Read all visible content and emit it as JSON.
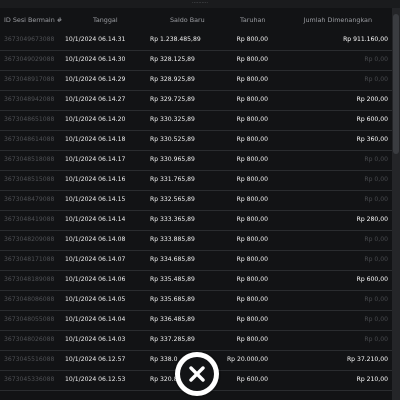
{
  "top_caption": "..........",
  "table": {
    "headers": [
      "ID Sesi Bermain #",
      "Tanggal",
      "Saldo Baru",
      "Taruhan",
      "Jumlah Dimenangkan"
    ],
    "rows": [
      {
        "id": "3673049673088",
        "date": "10/1/2024 06.14.31",
        "saldo": "Rp 1.238.485,89",
        "bet": "Rp 800,00",
        "win": "Rp 911.160,00"
      },
      {
        "id": "3673049029088",
        "date": "10/1/2024 06.14.30",
        "saldo": "Rp 328.125,89",
        "bet": "Rp 800,00",
        "win": "Rp 0,00"
      },
      {
        "id": "3673048917088",
        "date": "10/1/2024 06.14.29",
        "saldo": "Rp 328.925,89",
        "bet": "Rp 800,00",
        "win": "Rp 0,00"
      },
      {
        "id": "3673048942088",
        "date": "10/1/2024 06.14.27",
        "saldo": "Rp 329.725,89",
        "bet": "Rp 800,00",
        "win": "Rp 200,00"
      },
      {
        "id": "3673048651088",
        "date": "10/1/2024 06.14.20",
        "saldo": "Rp 330.325,89",
        "bet": "Rp 800,00",
        "win": "Rp 600,00"
      },
      {
        "id": "3673048614088",
        "date": "10/1/2024 06.14.18",
        "saldo": "Rp 330.525,89",
        "bet": "Rp 800,00",
        "win": "Rp 360,00"
      },
      {
        "id": "3673048518088",
        "date": "10/1/2024 06.14.17",
        "saldo": "Rp 330.965,89",
        "bet": "Rp 800,00",
        "win": "Rp 0,00"
      },
      {
        "id": "3673048515088",
        "date": "10/1/2024 06.14.16",
        "saldo": "Rp 331.765,89",
        "bet": "Rp 800,00",
        "win": "Rp 0,00"
      },
      {
        "id": "3673048479088",
        "date": "10/1/2024 06.14.15",
        "saldo": "Rp 332.565,89",
        "bet": "Rp 800,00",
        "win": "Rp 0,00"
      },
      {
        "id": "3673048419088",
        "date": "10/1/2024 06.14.14",
        "saldo": "Rp 333.365,89",
        "bet": "Rp 800,00",
        "win": "Rp 280,00"
      },
      {
        "id": "3673048209088",
        "date": "10/1/2024 06.14.08",
        "saldo": "Rp 333.885,89",
        "bet": "Rp 800,00",
        "win": "Rp 0,00"
      },
      {
        "id": "3673048171088",
        "date": "10/1/2024 06.14.07",
        "saldo": "Rp 334.685,89",
        "bet": "Rp 800,00",
        "win": "Rp 0,00"
      },
      {
        "id": "3673048189088",
        "date": "10/1/2024 06.14.06",
        "saldo": "Rp 335.485,89",
        "bet": "Rp 800,00",
        "win": "Rp 600,00"
      },
      {
        "id": "3673048086088",
        "date": "10/1/2024 06.14.05",
        "saldo": "Rp 335.685,89",
        "bet": "Rp 800,00",
        "win": "Rp 0,00"
      },
      {
        "id": "3673048055088",
        "date": "10/1/2024 06.14.04",
        "saldo": "Rp 336.485,89",
        "bet": "Rp 800,00",
        "win": "Rp 0,00"
      },
      {
        "id": "3673048026088",
        "date": "10/1/2024 06.14.03",
        "saldo": "Rp 337.285,89",
        "bet": "Rp 800,00",
        "win": "Rp 0,00"
      },
      {
        "id": "3673045516088",
        "date": "10/1/2024 06.12.57",
        "saldo": "Rp 338.0",
        "bet": "Rp 20.000,00",
        "win": "Rp 37.210,00"
      },
      {
        "id": "3673045336088",
        "date": "10/1/2024 06.12.53",
        "saldo": "Rp 320.8",
        "bet": "Rp 600,00",
        "win": "Rp 210,00"
      }
    ]
  },
  "close_button": {
    "icon": "close-icon"
  },
  "colors": {
    "background": "#121315",
    "text": "#f2f2f2",
    "muted": "#4a4c50",
    "button": "#ffffff"
  }
}
